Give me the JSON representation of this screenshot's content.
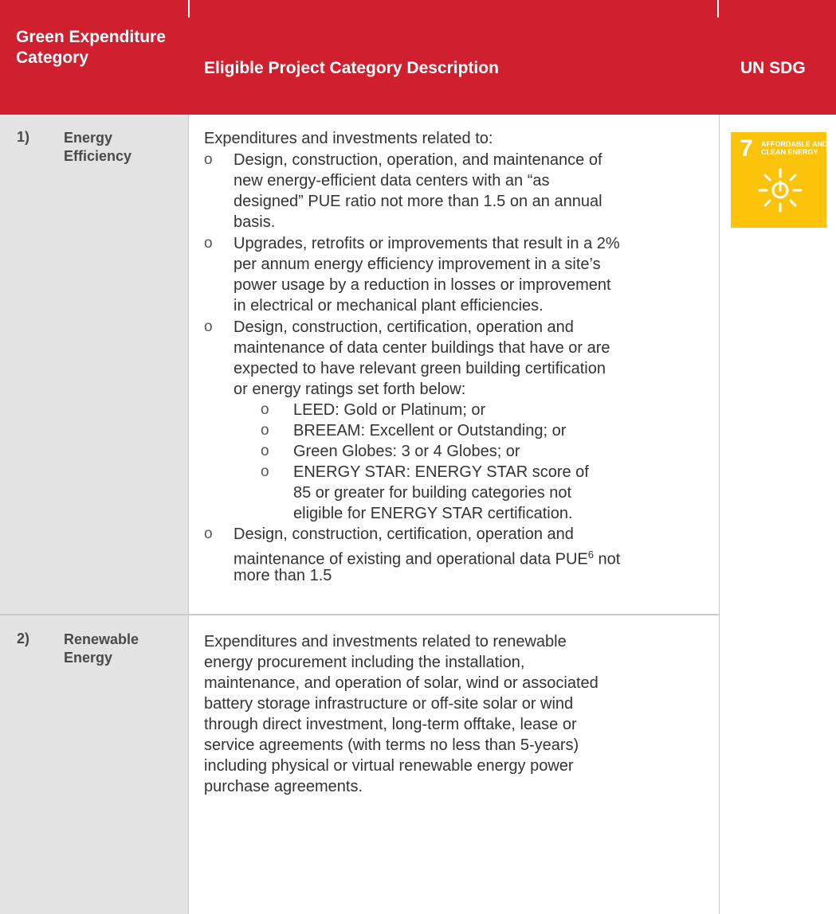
{
  "header": {
    "category": "Green Expenditure Category",
    "description": "Eligible Project Category Description",
    "sdg": "UN SDG"
  },
  "rows": [
    {
      "number": "1)",
      "category": "Energy Efficiency",
      "intro": "Expenditures and investments related to:",
      "bullets": [
        [
          "Design, construction, operation, and maintenance of",
          "new energy-efficient data centers with an “as",
          "designed” PUE ratio not more than 1.5 on an annual",
          "basis."
        ],
        [
          "Upgrades, retrofits or improvements that result in a 2%",
          "per annum energy efficiency improvement in a site’s",
          "power usage by a reduction in losses or improvement",
          "in electrical or mechanical plant efficiencies."
        ],
        [
          "Design, construction, certification, operation and",
          "maintenance of data center buildings that have or are",
          "expected to have relevant green building certification",
          "or energy ratings set forth below:"
        ]
      ],
      "sub_bullets": [
        [
          "LEED: Gold or Platinum; or"
        ],
        [
          "BREEAM: Excellent or Outstanding; or"
        ],
        [
          "Green Globes: 3 or 4 Globes; or"
        ],
        [
          "ENERGY STAR: ENERGY STAR score of",
          "85 or greater for building categories not",
          "eligible for ENERGY STAR certification."
        ]
      ],
      "last_bullet": {
        "line1": "Design, construction, certification, operation and",
        "line2_a": "maintenance of existing and operational data PUE",
        "footnote": "6",
        "line2_b": " not",
        "line3": "more than 1.5"
      },
      "bullet_symbol": "o"
    },
    {
      "number": "2)",
      "category": "Renewable Energy",
      "lines": [
        "Expenditures and investments related to renewable",
        "energy procurement including the installation,",
        "maintenance, and operation of solar, wind or associated",
        "battery storage infrastructure or off-site solar or wind",
        "through direct investment, long-term offtake, lease or",
        "service agreements (with terms no less than 5-years)",
        "including physical or virtual renewable energy power",
        "purchase agreements."
      ]
    }
  ],
  "sdg_tile": {
    "number": "7",
    "label": "AFFORDABLE AND\nCLEAN ENERGY",
    "icon": "sun-power-icon",
    "color": "#fcc30b"
  },
  "colors": {
    "header_bg": "#d0202f",
    "category_bg": "#e3e3e3",
    "text": "#333333"
  }
}
